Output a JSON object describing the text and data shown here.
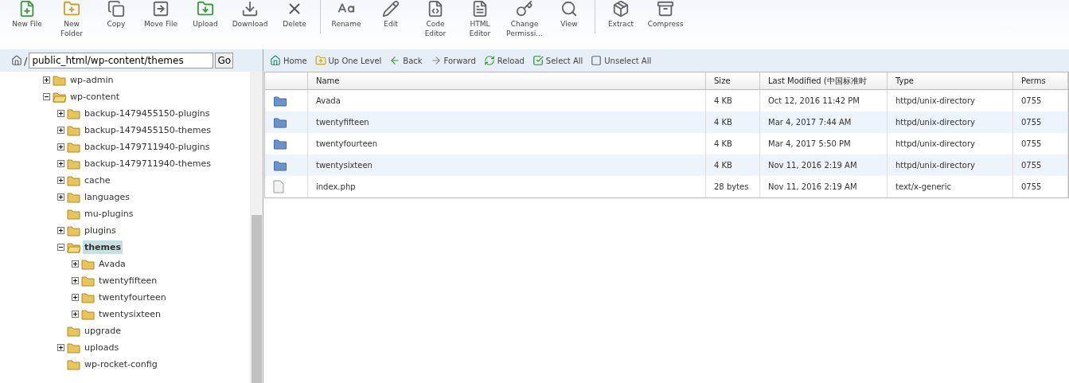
{
  "toolbar": [
    {
      "label": "New File",
      "kind": "newfile"
    },
    {
      "label": "New\nFolder",
      "kind": "newfolder"
    },
    {
      "label": "Copy",
      "kind": "copy"
    },
    {
      "label": "Move File",
      "kind": "move"
    },
    {
      "label": "Upload",
      "kind": "upload"
    },
    {
      "label": "Download",
      "kind": "download"
    },
    {
      "label": "Delete",
      "kind": "delete",
      "group_end": true
    },
    {
      "label": "Rename",
      "kind": "rename"
    },
    {
      "label": "Edit",
      "kind": "edit"
    },
    {
      "label": "Code\nEditor",
      "kind": "code"
    },
    {
      "label": "HTML\nEditor",
      "kind": "html"
    },
    {
      "label": "Change\nPermissi...",
      "kind": "perm"
    },
    {
      "label": "View",
      "kind": "view",
      "group_end": true
    },
    {
      "label": "Extract",
      "kind": "extract"
    },
    {
      "label": "Compress",
      "kind": "compress"
    }
  ],
  "path_bar": {
    "separator": "/",
    "value": "public_html/wp-content/themes",
    "go": "Go"
  },
  "tree": [
    {
      "label": "wp-admin",
      "expandable": true,
      "expanded": false,
      "selected": false
    },
    {
      "label": "wp-content",
      "expandable": true,
      "expanded": true,
      "selected": false,
      "children": [
        {
          "label": "backup-1479455150-plugins",
          "expandable": true,
          "expanded": false,
          "selected": false
        },
        {
          "label": "backup-1479455150-themes",
          "expandable": true,
          "expanded": false,
          "selected": false
        },
        {
          "label": "backup-1479711940-plugins",
          "expandable": true,
          "expanded": false,
          "selected": false
        },
        {
          "label": "backup-1479711940-themes",
          "expandable": true,
          "expanded": false,
          "selected": false
        },
        {
          "label": "cache",
          "expandable": true,
          "expanded": false,
          "selected": false
        },
        {
          "label": "languages",
          "expandable": true,
          "expanded": false,
          "selected": false
        },
        {
          "label": "mu-plugins",
          "expandable": false,
          "expanded": false,
          "selected": false
        },
        {
          "label": "plugins",
          "expandable": true,
          "expanded": false,
          "selected": false
        },
        {
          "label": "themes",
          "expandable": true,
          "expanded": true,
          "selected": true,
          "children": [
            {
              "label": "Avada",
              "expandable": true,
              "expanded": false,
              "selected": false
            },
            {
              "label": "twentyfifteen",
              "expandable": true,
              "expanded": false,
              "selected": false
            },
            {
              "label": "twentyfourteen",
              "expandable": true,
              "expanded": false,
              "selected": false
            },
            {
              "label": "twentysixteen",
              "expandable": true,
              "expanded": false,
              "selected": false
            }
          ]
        },
        {
          "label": "upgrade",
          "expandable": false,
          "expanded": false,
          "selected": false
        },
        {
          "label": "uploads",
          "expandable": true,
          "expanded": false,
          "selected": false
        },
        {
          "label": "wp-rocket-config",
          "expandable": false,
          "expanded": false,
          "selected": false
        }
      ]
    }
  ],
  "nav": [
    {
      "label": "Home",
      "kind": "home"
    },
    {
      "label": "Up One Level",
      "kind": "up"
    },
    {
      "label": "Back",
      "kind": "back"
    },
    {
      "label": "Forward",
      "kind": "forward"
    },
    {
      "label": "Reload",
      "kind": "reload"
    },
    {
      "label": "Select All",
      "kind": "selectall"
    },
    {
      "label": "Unselect All",
      "kind": "unselectall"
    }
  ],
  "table": {
    "columns": [
      "Name",
      "Size",
      "Last Modified (中国标准时",
      "Type",
      "Perms"
    ],
    "rows": [
      {
        "kind": "folder",
        "cells": [
          "Avada",
          "4 KB",
          "Oct 12, 2016 11:42 PM",
          "httpd/unix-directory",
          "0755"
        ]
      },
      {
        "kind": "folder",
        "cells": [
          "twentyfifteen",
          "4 KB",
          "Mar 4, 2017 7:44 AM",
          "httpd/unix-directory",
          "0755"
        ]
      },
      {
        "kind": "folder",
        "cells": [
          "twentyfourteen",
          "4 KB",
          "Mar 4, 2017 5:50 PM",
          "httpd/unix-directory",
          "0755"
        ]
      },
      {
        "kind": "folder",
        "cells": [
          "twentysixteen",
          "4 KB",
          "Nov 11, 2016 2:19 AM",
          "httpd/unix-directory",
          "0755"
        ]
      },
      {
        "kind": "file",
        "cells": [
          "index.php",
          "28 bytes",
          "Nov 11, 2016 2:19 AM",
          "text/x-generic",
          "0755"
        ]
      }
    ]
  }
}
